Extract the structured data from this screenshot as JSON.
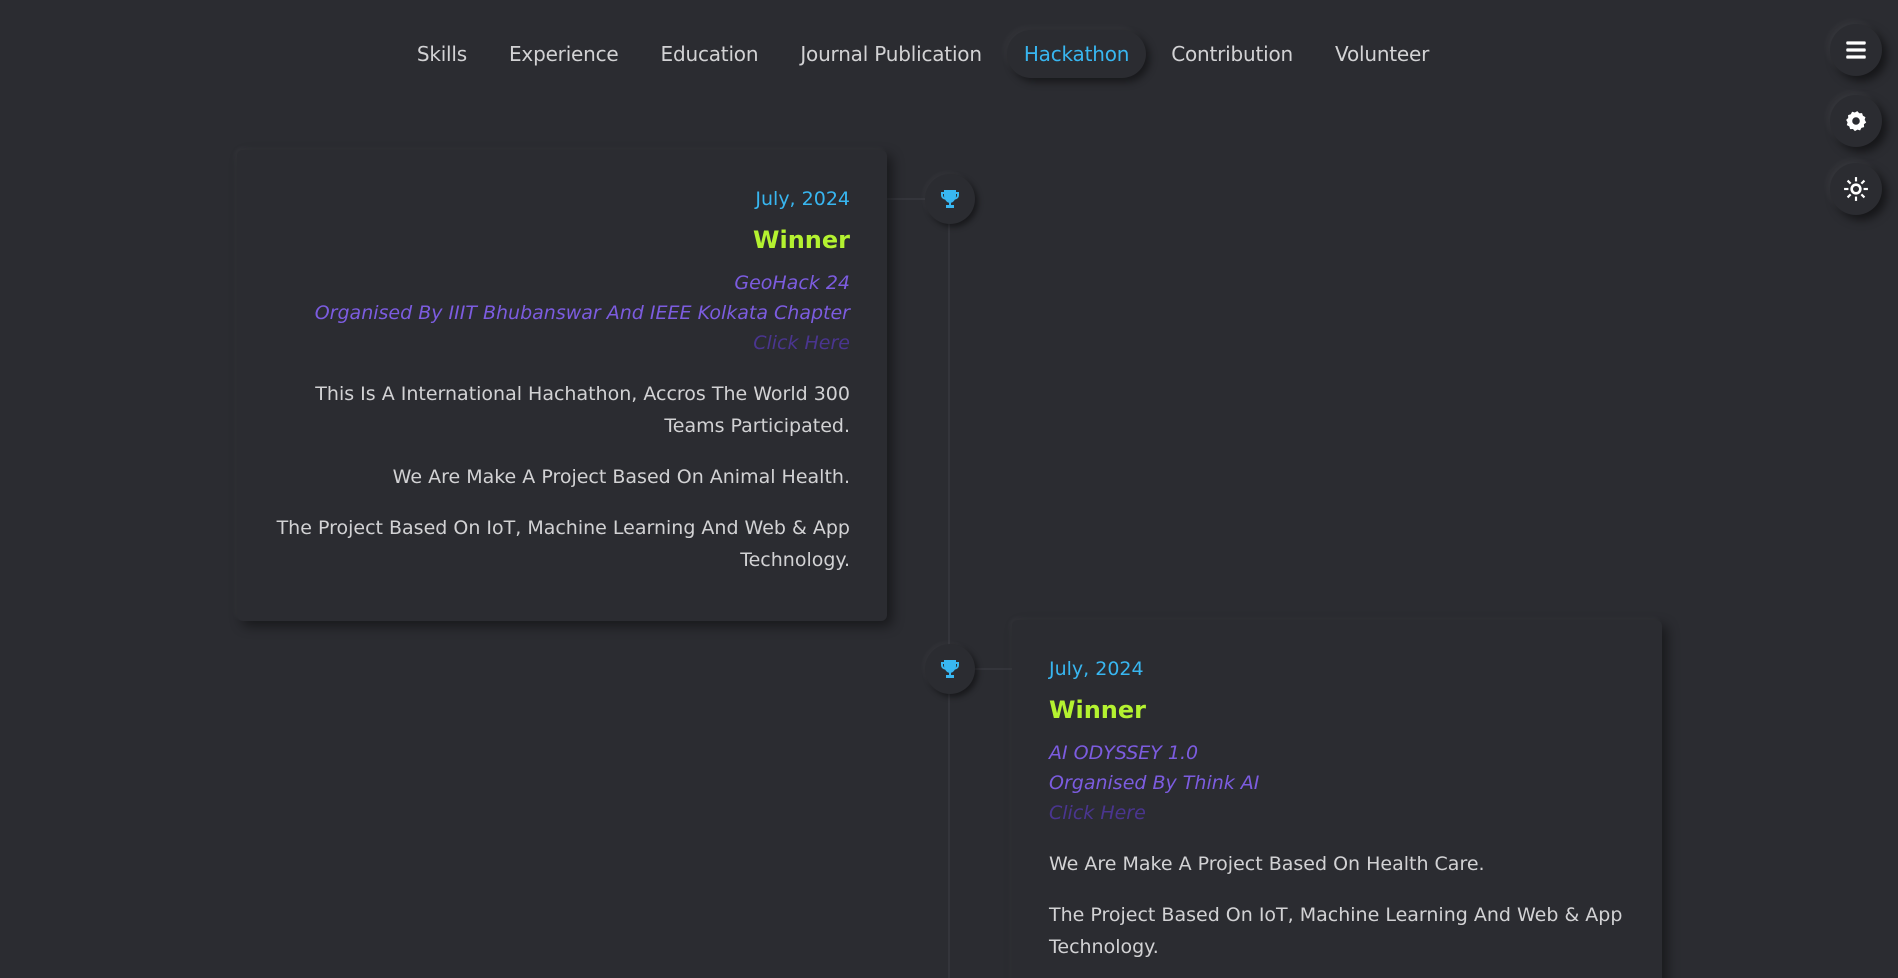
{
  "nav": {
    "tabs": [
      {
        "label": "Skills"
      },
      {
        "label": "Experience"
      },
      {
        "label": "Education"
      },
      {
        "label": "Journal Publication"
      },
      {
        "label": "Hackathon"
      },
      {
        "label": "Contribution"
      },
      {
        "label": "Volunteer"
      }
    ],
    "active_tab": "Hackathon"
  },
  "floating_buttons": [
    {
      "icon": "menu-icon"
    },
    {
      "icon": "gear-icon"
    },
    {
      "icon": "theme-toggle-icon"
    }
  ],
  "colors": {
    "background": "#2b2c31",
    "accent_blue": "#38b6f0",
    "accent_green": "#b4f230",
    "accent_purple": "#7c5ce0",
    "link_purple": "#4a3590",
    "text": "#d2d2d4"
  },
  "timeline": [
    {
      "side": "left",
      "icon": "trophy-icon",
      "date": "July, 2024",
      "title": "Winner",
      "event": "GeoHack 24",
      "organiser": "Organised By IIIT Bhubanswar And IEEE Kolkata Chapter",
      "link": "Click Here",
      "paragraphs": [
        "This Is A International Hachathon, Accros The World 300 Teams Participated.",
        "We Are Make A Project Based On Animal Health.",
        "The Project Based On IoT, Machine Learning And Web & App Technology."
      ]
    },
    {
      "side": "right",
      "icon": "trophy-icon",
      "date": "July, 2024",
      "title": "Winner",
      "event": "AI ODYSSEY 1.0",
      "organiser": "Organised By Think AI",
      "link": "Click Here",
      "paragraphs": [
        "We Are Make A Project Based On Health Care.",
        "The Project Based On IoT, Machine Learning And Web & App Technology."
      ]
    }
  ]
}
